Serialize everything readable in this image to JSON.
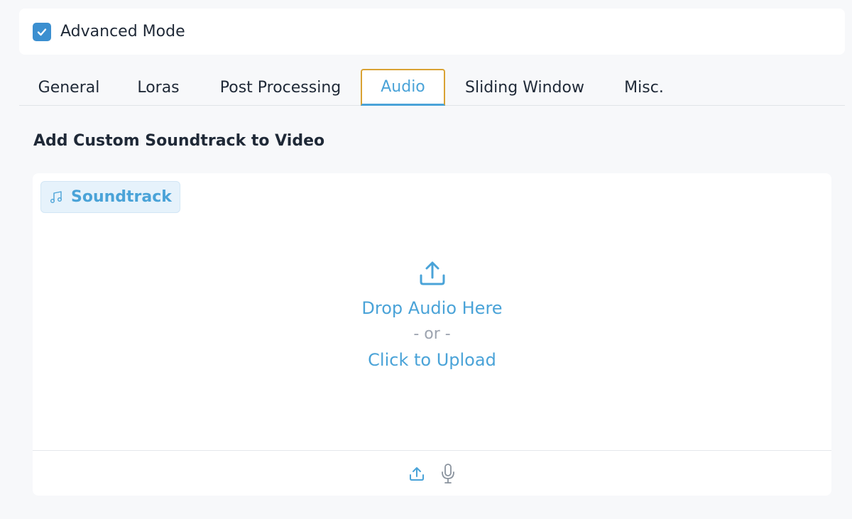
{
  "advanced_mode": {
    "label": "Advanced Mode",
    "checked": true
  },
  "tabs": [
    {
      "label": "General",
      "active": false
    },
    {
      "label": "Loras",
      "active": false
    },
    {
      "label": "Post Processing",
      "active": false
    },
    {
      "label": "Audio",
      "active": true
    },
    {
      "label": "Sliding Window",
      "active": false
    },
    {
      "label": "Misc.",
      "active": false
    }
  ],
  "section": {
    "title": "Add Custom Soundtrack to Video"
  },
  "audio_input": {
    "label": "Soundtrack",
    "label_icon": "music-note-icon",
    "drop_text": "Drop Audio Here",
    "or_text": "- or -",
    "click_text": "Click to Upload",
    "footer_icons": [
      "upload-icon",
      "microphone-icon"
    ]
  },
  "colors": {
    "accent": "#4aa3d8",
    "checkbox": "#3b8fd0",
    "active_tab_border": "#d9a233",
    "label_bg": "#e6f2fb",
    "muted_text": "#9ca3af",
    "background": "#f7f8fa"
  }
}
